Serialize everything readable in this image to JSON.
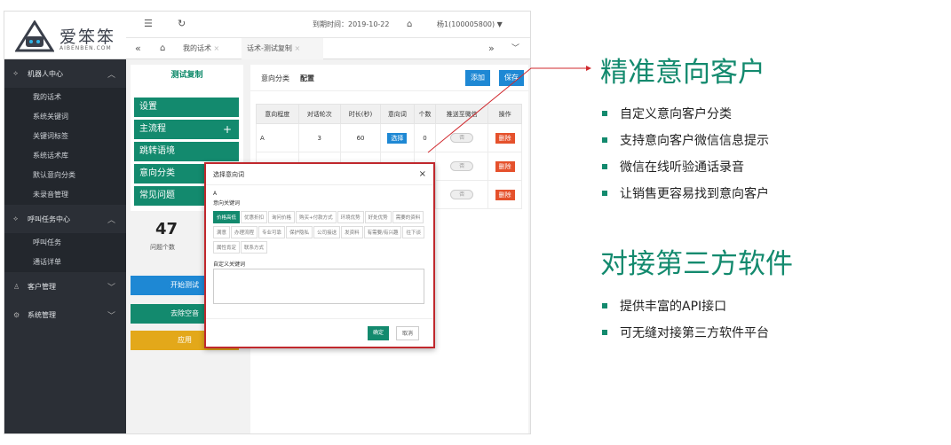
{
  "logo": {
    "name": "爱笨笨",
    "sub": "AIBENBEN.COM"
  },
  "sidebar": {
    "groups": [
      {
        "label": "机器人中心",
        "items": [
          "我的话术",
          "系统关键词",
          "关键词标签",
          "系统话术库",
          "默认意向分类",
          "未录音管理"
        ]
      },
      {
        "label": "呼叫任务中心",
        "items": [
          "呼叫任务",
          "通话详单"
        ]
      },
      {
        "label": "客户管理",
        "items": []
      },
      {
        "label": "系统管理",
        "items": []
      }
    ]
  },
  "topbar": {
    "expire": "到期时间：2019-10-22",
    "user": "杨1(100005800) ▼"
  },
  "tabs": {
    "home": "⌂",
    "t1": "我的话术",
    "t2": "话术-测试复制"
  },
  "left": {
    "title": "测试复制",
    "items": [
      "设置",
      "主流程",
      "跳转语境",
      "意向分类",
      "常见问题"
    ],
    "stat_num": "47",
    "stat_label": "问题个数",
    "btn_start": "开始测试",
    "btn_remove": "去除空音",
    "btn_apply": "应用"
  },
  "right": {
    "label": "意向分类",
    "value": "配置",
    "add": "添加",
    "save": "保存",
    "headers": [
      "意向程度",
      "对话轮次",
      "时长(秒)",
      "意向词",
      "个数",
      "推送至微信",
      "操作"
    ],
    "row1": {
      "level": "A",
      "rounds": "3",
      "dur": "60",
      "word": "选择",
      "count": "0",
      "toggle": "否",
      "op": "删除"
    },
    "toggle2": "否",
    "toggle3": "否",
    "op": "删除"
  },
  "modal": {
    "title": "选择意向词",
    "level": "A",
    "kw_label": "意向关键词",
    "tags": [
      "价格高低",
      "优惠折扣",
      "询问价格",
      "购买+付款方式",
      "环境优势",
      "好处优势",
      "需要的资料",
      "满意",
      "办理流程",
      "专业可靠",
      "保护隐私",
      "公司接送",
      "发资料",
      "有需要/有兴趣",
      "往下谈",
      "属性肯定",
      "联系方式"
    ],
    "custom_label": "自定义关键词",
    "ok": "确定",
    "cancel": "取消"
  },
  "promo": {
    "title1": "精准意向客户",
    "bullets1": [
      "自定义意向客户分类",
      "支持意向客户微信信息提示",
      "微信在线听验通话录音",
      "让销售更容易找到意向客户"
    ],
    "title2": "对接第三方软件",
    "bullets2": [
      "提供丰富的API接口",
      "可无缝对接第三方软件平台"
    ]
  }
}
